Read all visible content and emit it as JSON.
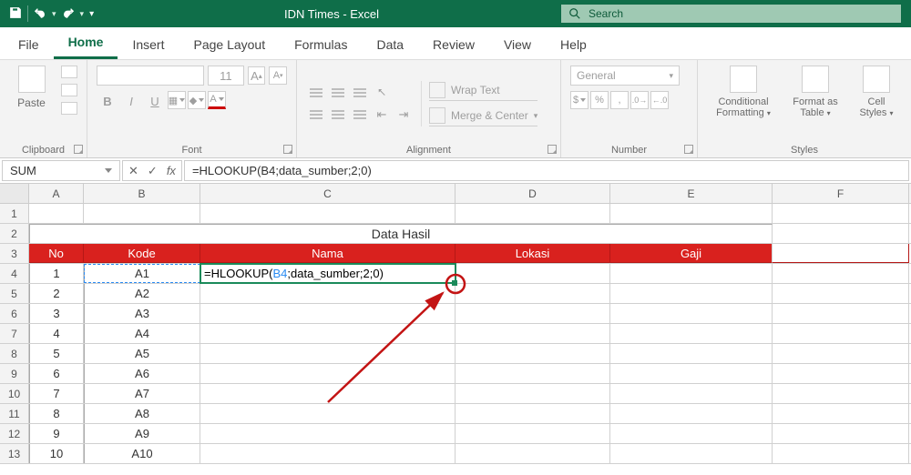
{
  "app": {
    "title": "IDN Times  -  Excel",
    "search_placeholder": "Search"
  },
  "tabs": {
    "file": "File",
    "home": "Home",
    "insert": "Insert",
    "pagelayout": "Page Layout",
    "formulas": "Formulas",
    "data": "Data",
    "review": "Review",
    "view": "View",
    "help": "Help"
  },
  "ribbon": {
    "clipboard": {
      "paste": "Paste",
      "label": "Clipboard"
    },
    "font": {
      "label": "Font",
      "size": "11",
      "B": "B",
      "I": "I",
      "U": "U",
      "grow": "A",
      "shrink": "A"
    },
    "alignment": {
      "label": "Alignment",
      "wrap": "Wrap Text",
      "merge": "Merge & Center"
    },
    "number": {
      "label": "Number",
      "format": "General",
      "percent": "%",
      "comma": ","
    },
    "styles": {
      "label": "Styles",
      "cond": "Conditional Formatting",
      "table": "Format as Table",
      "cell": "Cell Styles"
    }
  },
  "fbar": {
    "name": "SUM",
    "formula": "=HLOOKUP(B4;data_sumber;2;0)",
    "fx": "fx"
  },
  "columns": {
    "A": "A",
    "B": "B",
    "C": "C",
    "D": "D",
    "E": "E",
    "F": "F"
  },
  "sheet": {
    "title": "Data Hasil",
    "headers": {
      "no": "No",
      "kode": "Kode",
      "nama": "Nama",
      "lokasi": "Lokasi",
      "gaji": "Gaji"
    },
    "cell_c4": "=HLOOKUP(B4;data_sumber;2;0)",
    "cell_c4_ref": "B4",
    "rows": [
      {
        "n": "1",
        "no": "1",
        "kode": "A1"
      },
      {
        "n": "2",
        "no": "2",
        "kode": "A2"
      },
      {
        "n": "3",
        "no": "3",
        "kode": "A3"
      },
      {
        "n": "4",
        "no": "4",
        "kode": "A4"
      },
      {
        "n": "5",
        "no": "5",
        "kode": "A5"
      },
      {
        "n": "6",
        "no": "6",
        "kode": "A6"
      },
      {
        "n": "7",
        "no": "7",
        "kode": "A7"
      },
      {
        "n": "8",
        "no": "8",
        "kode": "A8"
      },
      {
        "n": "9",
        "no": "9",
        "kode": "A9"
      },
      {
        "n": "10",
        "no": "10",
        "kode": "A10"
      }
    ],
    "row_numbers": [
      "1",
      "2",
      "3",
      "4",
      "5",
      "6",
      "7",
      "8",
      "9",
      "10",
      "11",
      "12",
      "13"
    ]
  }
}
